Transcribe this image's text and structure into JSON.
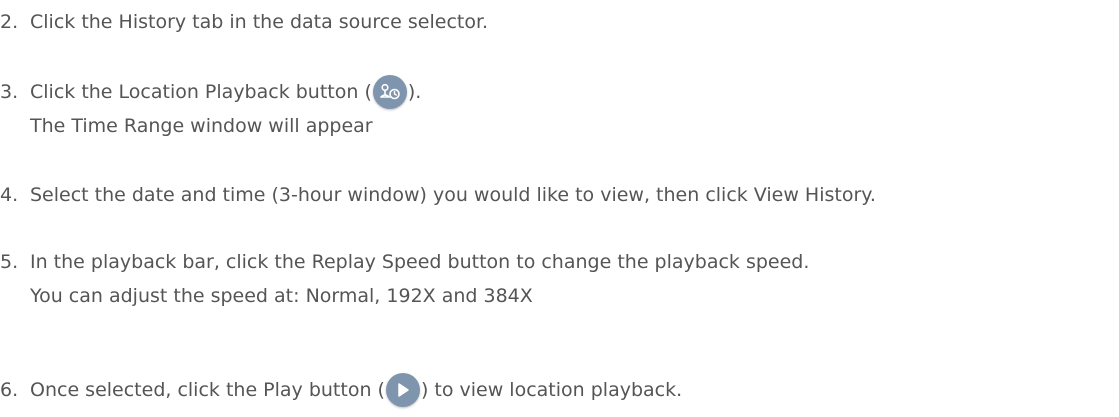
{
  "steps": [
    {
      "number": "2.",
      "text": "Click the History tab in the data source selector."
    },
    {
      "number": "3.",
      "text_before": "Click the Location Playback button (",
      "icon": "location-playback-icon",
      "text_after": ").",
      "subtext": "The Time Range window will appear"
    },
    {
      "number": "4.",
      "text": "Select the date and time (3-hour window) you would like to view, then click View History."
    },
    {
      "number": "5.",
      "text": "In the playback bar, click the Replay Speed button to change the playback speed.",
      "subtext": "You can adjust the speed at: Normal, 192X and 384X"
    },
    {
      "number": "6.",
      "text_before": "Once selected, click the Play button (",
      "icon": "play-icon",
      "text_after": ") to view location playback."
    }
  ],
  "colors": {
    "text": "#555555",
    "icon_background": "#7f95ad"
  }
}
